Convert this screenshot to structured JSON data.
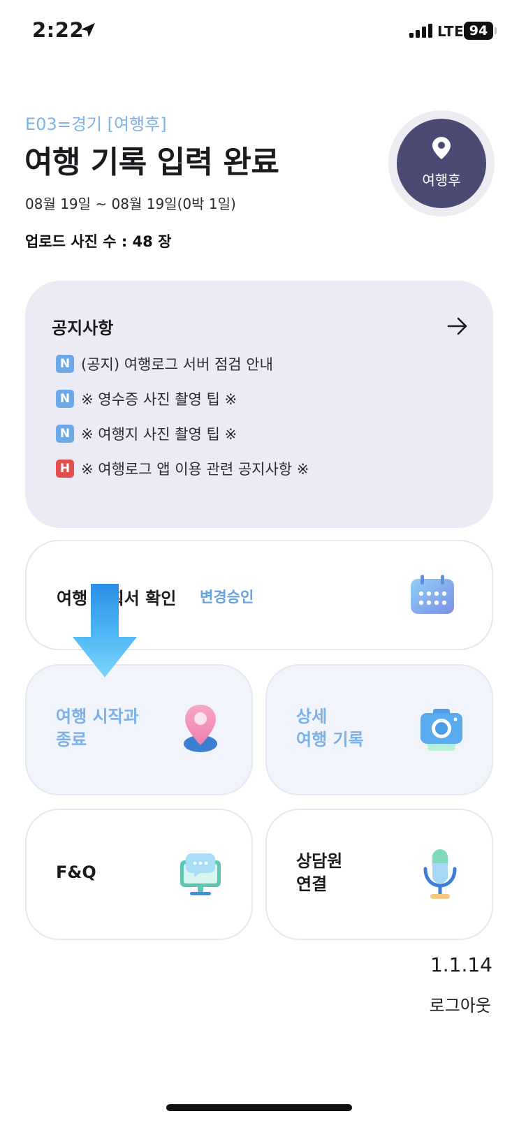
{
  "status_bar": {
    "time": "2:22",
    "network": "LTE",
    "battery": "94"
  },
  "header": {
    "trip_code": "E03=경기 [여행후]",
    "title": "여행 기록 입력 완료",
    "date_range": "08월 19일 ~ 08월 19일(0박 1일)",
    "upload_count": "업로드 사진 수 : 48 장",
    "status_label": "여행후"
  },
  "notice": {
    "title": "공지사항",
    "items": [
      {
        "badge": "N",
        "text": "(공지) 여행로그 서버 점검 안내"
      },
      {
        "badge": "N",
        "text": "※ 영수증 사진 촬영 팁 ※"
      },
      {
        "badge": "N",
        "text": "※ 여행지 사진 촬영 팁 ※"
      },
      {
        "badge": "H",
        "text": "※ 여행로그 앱 이용 관련 공지사항 ※"
      }
    ]
  },
  "menu": {
    "plan": {
      "label": "여행 계획서 확인",
      "link": "변경승인"
    },
    "trip_start": {
      "line1": "여행 시작과",
      "line2": "종료"
    },
    "detail_record": {
      "line1": "상세",
      "line2": "여행 기록"
    },
    "faq": {
      "label": "F&Q"
    },
    "counsel": {
      "line1": "상담원",
      "line2": "연결"
    }
  },
  "footer": {
    "version": "1.1.14",
    "logout": "로그아웃"
  },
  "colors": {
    "accent_blue": "#67a3e0",
    "status_circle": "#4b4a73",
    "notice_bg": "#ebebf6",
    "badge_new": "#6ca9e6",
    "badge_hot": "#e34f4f",
    "arrow": "#4fb8f5"
  },
  "icons": {
    "status_bar": [
      "location-arrow-icon",
      "signal-icon"
    ],
    "notice": "arrow-right-icon",
    "plan": "calendar-icon",
    "trip_start": "map-pin-icon",
    "detail_record": "camera-icon",
    "faq": "chat-monitor-icon",
    "counsel": "microphone-icon",
    "header": "map-pin-icon"
  }
}
